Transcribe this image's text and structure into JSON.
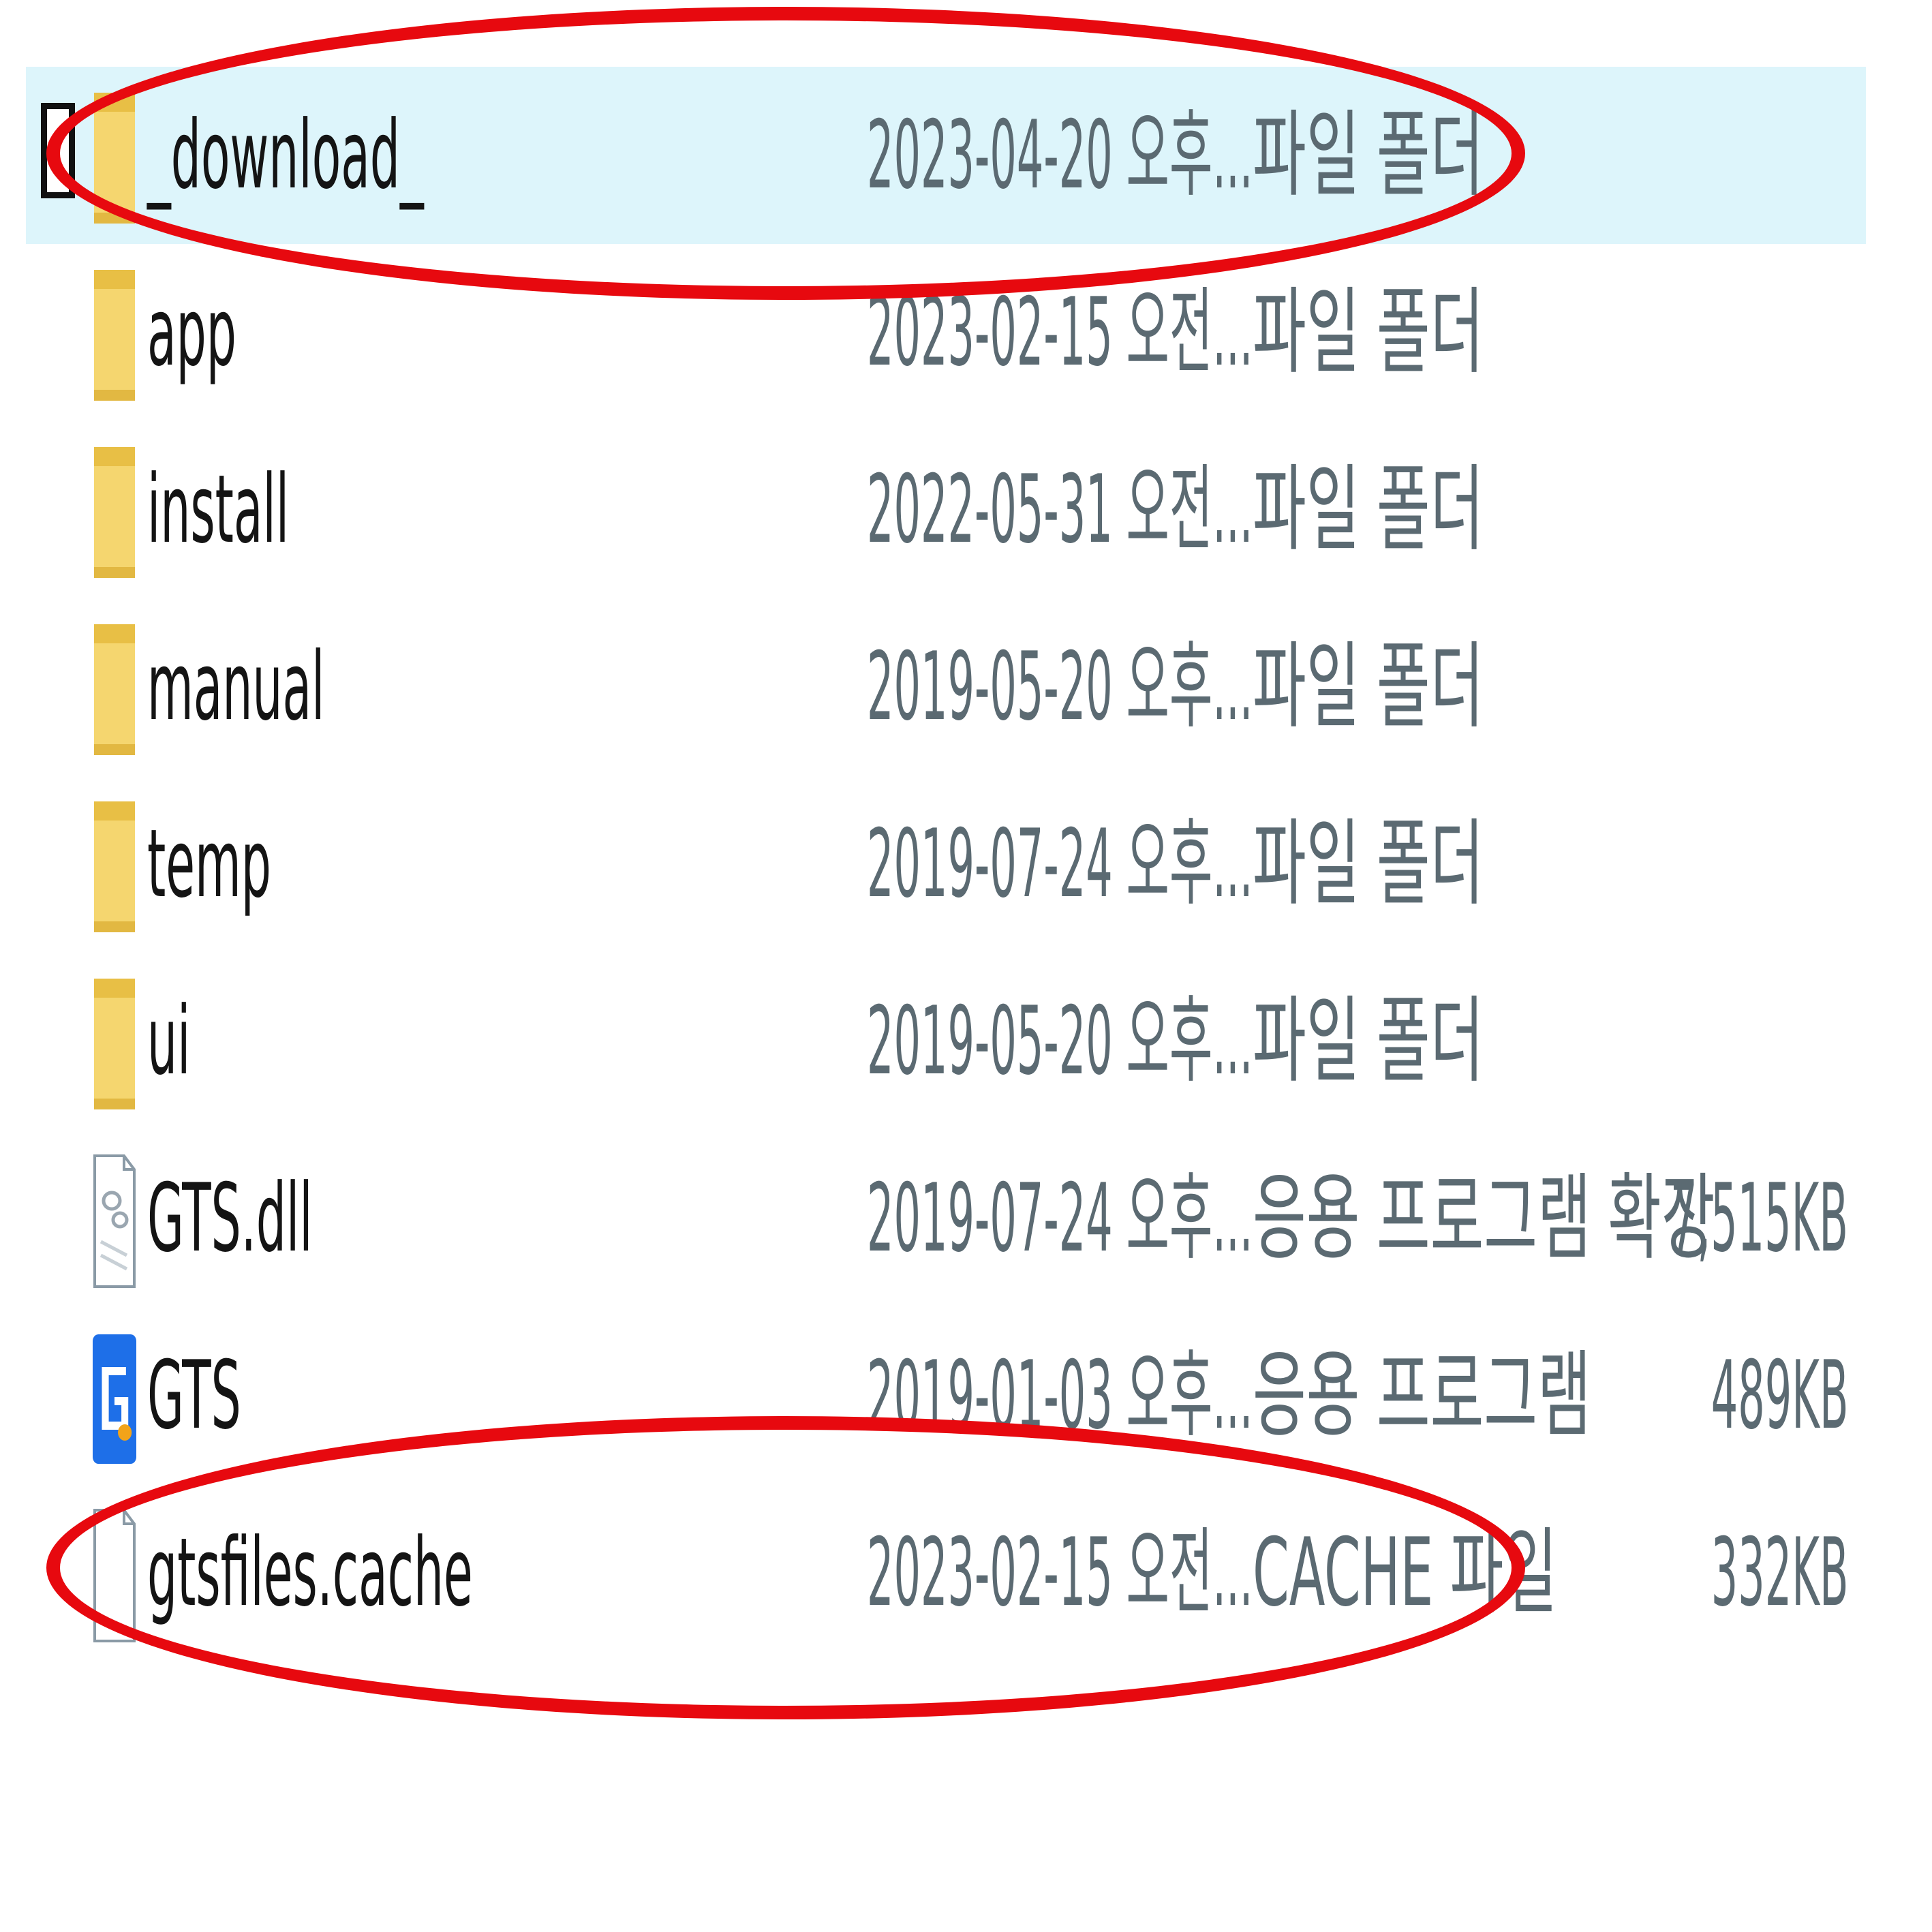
{
  "file_list": {
    "rows": [
      {
        "name": "_download_",
        "date": "2023-04-20 오후...",
        "type": "파일 폴더",
        "size": "",
        "icon": "folder-icon",
        "selected": true
      },
      {
        "name": "app",
        "date": "2023-02-15 오전...",
        "type": "파일 폴더",
        "size": "",
        "icon": "folder-icon",
        "selected": false
      },
      {
        "name": "install",
        "date": "2022-05-31 오전...",
        "type": "파일 폴더",
        "size": "",
        "icon": "folder-icon",
        "selected": false
      },
      {
        "name": "manual",
        "date": "2019-05-20 오후...",
        "type": "파일 폴더",
        "size": "",
        "icon": "folder-icon",
        "selected": false
      },
      {
        "name": "temp",
        "date": "2019-07-24 오후...",
        "type": "파일 폴더",
        "size": "",
        "icon": "folder-icon",
        "selected": false
      },
      {
        "name": "ui",
        "date": "2019-05-20 오후...",
        "type": "파일 폴더",
        "size": "",
        "icon": "folder-icon",
        "selected": false
      },
      {
        "name": "GTS.dll",
        "date": "2019-07-24 오후...",
        "type": "응용 프로그램 확장",
        "size": "7,515KB",
        "icon": "dll-file-icon",
        "selected": false
      },
      {
        "name": "GTS",
        "date": "2019-01-03 오후...",
        "type": "응용 프로그램",
        "size": "489KB",
        "icon": "gts-app-icon",
        "selected": false
      },
      {
        "name": "gtsfiles.cache",
        "date": "2023-02-15 오전...",
        "type": "CACHE 파일",
        "size": "332KB",
        "icon": "file-icon",
        "selected": false
      }
    ]
  },
  "colors": {
    "selection_background": "#ddf5fb",
    "annotation_red": "#e7090f",
    "folder_yellow": "#f5d66f",
    "app_icon_blue": "#1e6fe8"
  }
}
